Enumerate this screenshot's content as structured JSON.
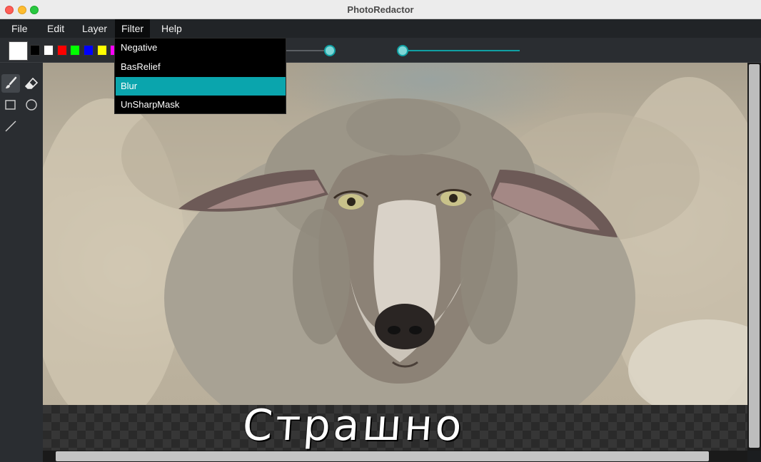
{
  "window": {
    "title": "PhotoRedactor"
  },
  "menu": {
    "items": [
      {
        "label": "File"
      },
      {
        "label": "Edit"
      },
      {
        "label": "Layer"
      },
      {
        "label": "Filter"
      },
      {
        "label": "Help"
      }
    ],
    "active": "Filter"
  },
  "filter_menu": {
    "items": [
      {
        "label": "Negative"
      },
      {
        "label": "BasRelief"
      },
      {
        "label": "Blur"
      },
      {
        "label": "UnSharpMask"
      }
    ],
    "highlighted": "Blur"
  },
  "toolbar": {
    "current_color": "#ffffff",
    "swatches": [
      "#000000",
      "#ffffff",
      "#ff0000",
      "#00ff00",
      "#0000ff",
      "#ffff00",
      "#ff00ff"
    ],
    "slider_color": "#10a0a3"
  },
  "tools": [
    {
      "icon": "brush-icon",
      "selected": true
    },
    {
      "icon": "eraser-icon",
      "selected": false
    },
    {
      "icon": "rectangle-icon",
      "selected": false
    },
    {
      "icon": "ellipse-icon",
      "selected": false
    },
    {
      "icon": "line-icon",
      "selected": false
    }
  ],
  "canvas": {
    "caption": "Страшно"
  }
}
